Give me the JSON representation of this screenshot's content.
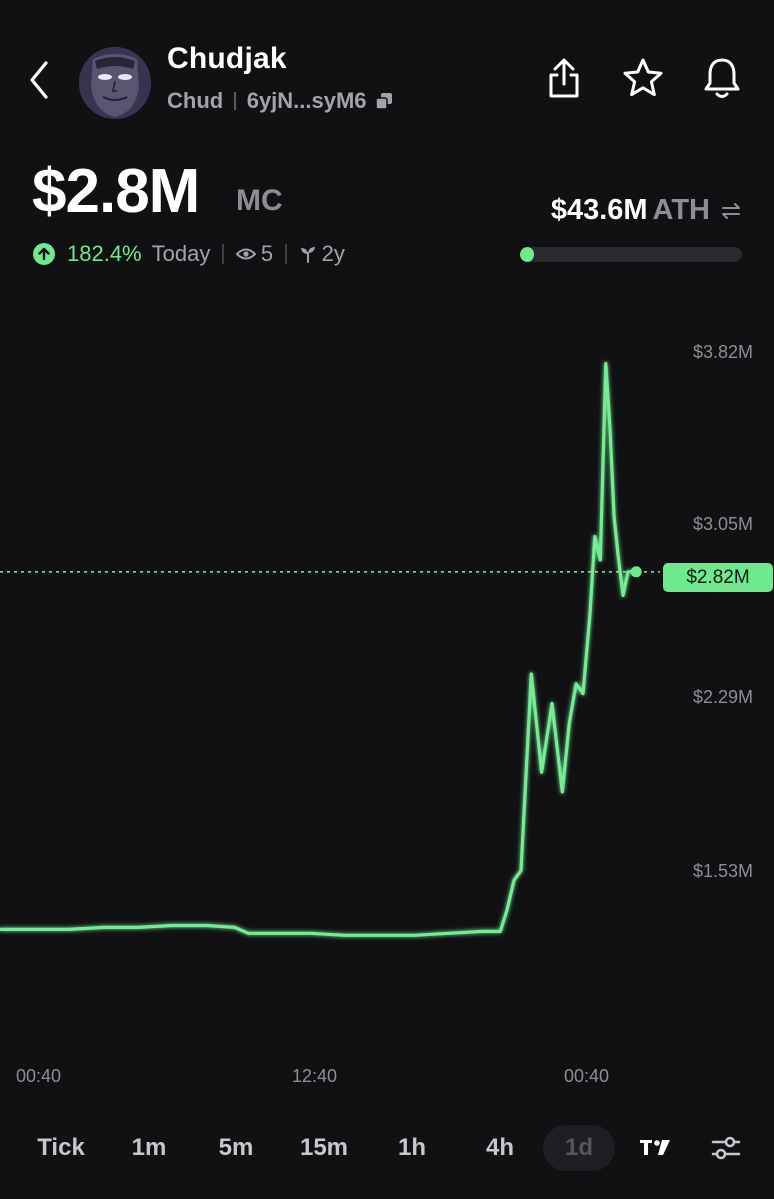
{
  "header": {
    "token_name": "Chudjak",
    "ticker": "Chud",
    "address_short": "6yjN...syM6"
  },
  "market_cap": {
    "value": "$2.8M",
    "label": "MC"
  },
  "change": {
    "percent": "182.4%",
    "period": "Today",
    "watchers": "5",
    "age": "2y"
  },
  "ath": {
    "value": "$43.6M",
    "label": "ATH",
    "progress_fraction": 0.064
  },
  "chart_data": {
    "type": "line",
    "y_ticks": [
      "$3.82M",
      "$3.05M",
      "$2.29M",
      "$1.53M"
    ],
    "x_ticks": [
      "00:40",
      "12:40",
      "00:40"
    ],
    "current_price_label": "$2.82M",
    "current_value": 2.82,
    "ylim": [
      0.6,
      4.0
    ],
    "y_unit": "M USD",
    "grid": false,
    "line_color": "#6ee98e",
    "series": [
      {
        "values": [
          [
            0.0,
            1.0
          ],
          [
            0.05,
            1.0
          ],
          [
            0.1,
            1.0
          ],
          [
            0.15,
            1.01
          ],
          [
            0.2,
            1.01
          ],
          [
            0.25,
            1.02
          ],
          [
            0.3,
            1.02
          ],
          [
            0.34,
            1.01
          ],
          [
            0.36,
            0.98
          ],
          [
            0.4,
            0.98
          ],
          [
            0.45,
            0.98
          ],
          [
            0.5,
            0.97
          ],
          [
            0.55,
            0.97
          ],
          [
            0.6,
            0.97
          ],
          [
            0.65,
            0.98
          ],
          [
            0.7,
            0.99
          ],
          [
            0.725,
            0.99
          ],
          [
            0.735,
            1.1
          ],
          [
            0.745,
            1.25
          ],
          [
            0.755,
            1.3
          ],
          [
            0.77,
            2.3
          ],
          [
            0.785,
            1.8
          ],
          [
            0.8,
            2.15
          ],
          [
            0.815,
            1.7
          ],
          [
            0.825,
            2.05
          ],
          [
            0.835,
            2.25
          ],
          [
            0.845,
            2.2
          ],
          [
            0.855,
            2.6
          ],
          [
            0.862,
            3.0
          ],
          [
            0.87,
            2.88
          ],
          [
            0.878,
            3.88
          ],
          [
            0.884,
            3.55
          ],
          [
            0.89,
            3.1
          ],
          [
            0.896,
            2.9
          ],
          [
            0.903,
            2.7
          ],
          [
            0.91,
            2.82
          ],
          [
            0.922,
            2.82
          ]
        ]
      }
    ]
  },
  "timeframes": [
    {
      "label": "Tick"
    },
    {
      "label": "1m"
    },
    {
      "label": "5m"
    },
    {
      "label": "15m"
    },
    {
      "label": "1h"
    },
    {
      "label": "4h"
    },
    {
      "label": "1d",
      "active": true
    }
  ],
  "colors": {
    "accent": "#6ee98e",
    "background": "#111113",
    "muted_text": "#8d8d93"
  },
  "icons": {
    "back": "chevron-left-icon",
    "share": "share-icon",
    "favorite": "star-icon",
    "alerts": "bell-icon",
    "copy": "copy-icon",
    "up": "arrow-up-circle-icon",
    "watchers": "eye-icon",
    "age": "sprout-icon",
    "ath_toggle": "swap-icon",
    "chart_style": "tradingview-icon",
    "settings": "sliders-icon"
  }
}
